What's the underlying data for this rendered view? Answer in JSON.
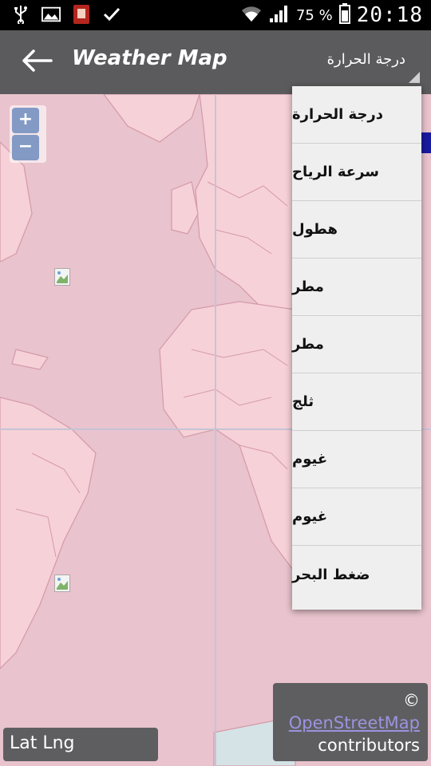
{
  "status_bar": {
    "battery_text": "75 %",
    "time": "20:18",
    "icons": [
      "usb-icon",
      "image-icon",
      "app-icon",
      "check-icon",
      "wifi-icon",
      "signal-icon",
      "battery-icon"
    ]
  },
  "action_bar": {
    "title": "Weather Map",
    "spinner_selected": "درجة الحرارة",
    "back_icon": "arrow-left-icon"
  },
  "map": {
    "zoom_in": "+",
    "zoom_out": "−",
    "lat_lng": "Lat Lng",
    "attribution": {
      "copyright": "©",
      "link_text": "OpenStreetMap",
      "suffix": "contributors"
    },
    "colors": {
      "overlay": "#f3ccd3",
      "land_lines": "#d9a6b3",
      "grid": "#c6c3d6"
    }
  },
  "dropdown": {
    "items": [
      "درجة الحرارة",
      "سرعة الرياح",
      "هطول",
      "مطر",
      "مطر",
      "ثلج",
      "غيوم",
      "غيوم",
      "ضغط البحر"
    ]
  }
}
